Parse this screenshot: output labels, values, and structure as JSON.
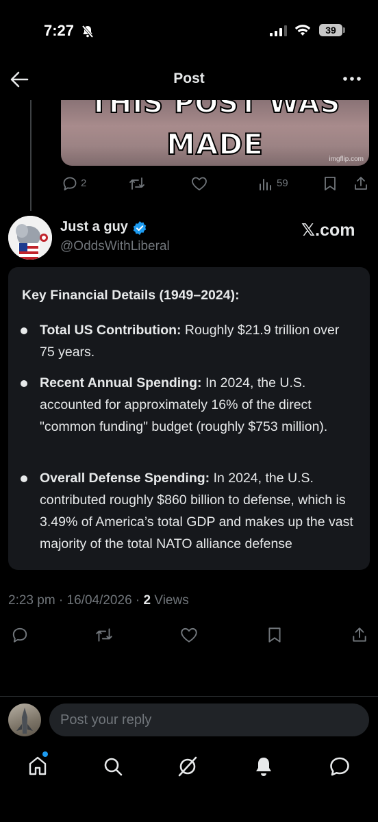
{
  "status_bar": {
    "time": "7:27",
    "battery": "39"
  },
  "header": {
    "title": "Post"
  },
  "previous_post": {
    "meme_text_line1": "THIS POST WAS",
    "meme_text_line2": "MADE",
    "meme_watermark": "imgflip.com",
    "replies": "2",
    "views": "59"
  },
  "post": {
    "author_name": "Just a guy",
    "author_handle": "@OddsWithLiberal",
    "source_label": "𝕏.com",
    "card": {
      "title": "Key Financial Details (1949–2024):",
      "bullets": [
        {
          "label": "Total US Contribution:",
          "text": " Roughly $21.9 trillion over 75 years."
        },
        {
          "label": "Recent Annual Spending:",
          "text": " In 2024, the U.S. accounted for approximately 16% of the direct \"common funding\" budget (roughly $753 million)."
        },
        {
          "label": "Overall Defense Spending:",
          "text": " In 2024, the U.S. contributed roughly $860 billion to defense, which is 3.49% of America’s total GDP and makes up the vast majority of the total NATO alliance defense"
        }
      ]
    },
    "timestamp": "2:23 pm · 16/04/2026 · ",
    "views_count": "2",
    "views_label": " Views"
  },
  "reply": {
    "placeholder": "Post your reply"
  },
  "colors": {
    "accent": "#1d9bf0",
    "muted": "#71767b",
    "text": "#e7e9ea",
    "card_bg": "#16181c"
  },
  "icons": {
    "status": [
      "bell-slash-icon",
      "signal-icon",
      "wifi-icon",
      "battery-icon"
    ],
    "header": [
      "back-arrow-icon",
      "more-icon"
    ],
    "actions": [
      "reply-icon",
      "repost-icon",
      "like-icon",
      "views-icon",
      "bookmark-icon",
      "share-icon"
    ],
    "nav": [
      "home-icon",
      "search-icon",
      "grok-icon",
      "notifications-icon",
      "messages-icon"
    ]
  }
}
